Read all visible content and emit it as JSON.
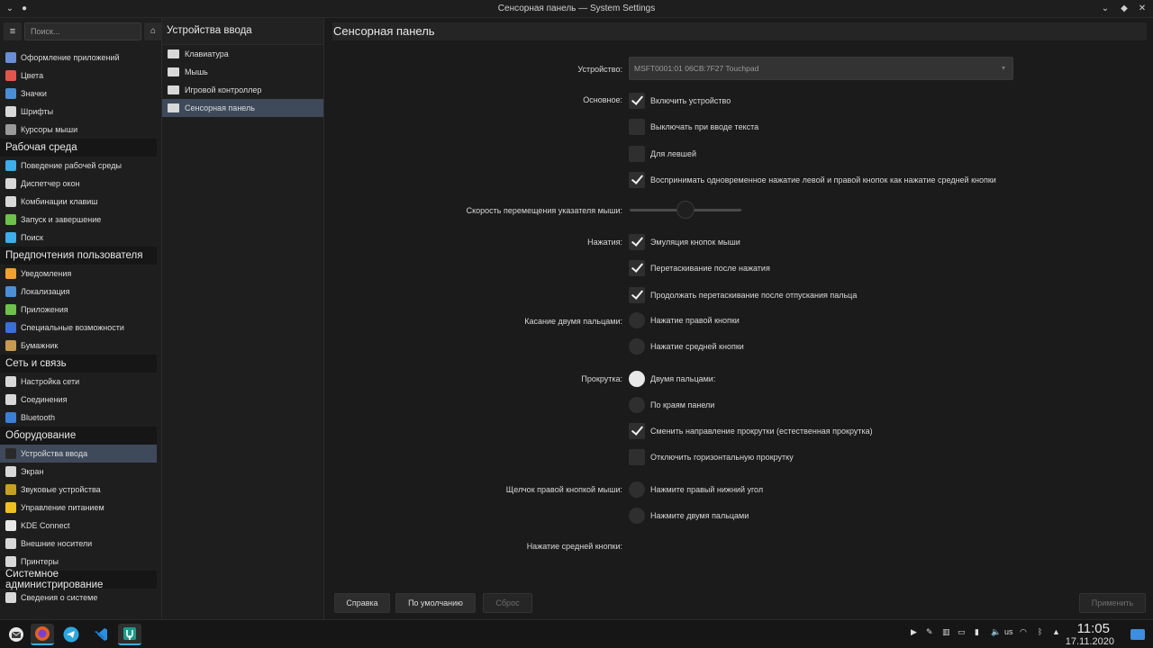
{
  "window": {
    "title": "Сенсорная панель — System Settings",
    "min_icon": "minimize-icon",
    "max_icon": "maximize-icon",
    "close_icon": "close-icon"
  },
  "sidebar": {
    "search_placeholder": "Поиск...",
    "sections": [
      {
        "type": "item",
        "label": "Оформление приложений",
        "icon": "appearance-icon",
        "color": "#6a8fd6"
      },
      {
        "type": "item",
        "label": "Цвета",
        "icon": "colors-icon",
        "color": "#e0564a"
      },
      {
        "type": "item",
        "label": "Значки",
        "icon": "icons-icon",
        "color": "#4a8fd6"
      },
      {
        "type": "item",
        "label": "Шрифты",
        "icon": "fonts-icon",
        "color": "#d8d8d8"
      },
      {
        "type": "item",
        "label": "Курсоры мыши",
        "icon": "cursor-icon",
        "color": "#9a9a9a"
      },
      {
        "type": "category",
        "label": "Рабочая среда"
      },
      {
        "type": "item",
        "label": "Поведение рабочей среды",
        "icon": "desktop-behavior-icon",
        "color": "#3daee9"
      },
      {
        "type": "item",
        "label": "Диспетчер окон",
        "icon": "window-manager-icon",
        "color": "#d8d8d8"
      },
      {
        "type": "item",
        "label": "Комбинации клавиш",
        "icon": "shortcuts-icon",
        "color": "#d8d8d8"
      },
      {
        "type": "item",
        "label": "Запуск и завершение",
        "icon": "startup-icon",
        "color": "#6cc24a"
      },
      {
        "type": "item",
        "label": "Поиск",
        "icon": "search-icon",
        "color": "#3daee9"
      },
      {
        "type": "category",
        "label": "Предпочтения пользователя"
      },
      {
        "type": "item",
        "label": "Уведомления",
        "icon": "bell-icon",
        "color": "#f0a030"
      },
      {
        "type": "item",
        "label": "Локализация",
        "icon": "locale-icon",
        "color": "#4a8fd6"
      },
      {
        "type": "item",
        "label": "Приложения",
        "icon": "star-icon",
        "color": "#6cc24a"
      },
      {
        "type": "item",
        "label": "Специальные возможности",
        "icon": "accessibility-icon",
        "color": "#3a6fd6"
      },
      {
        "type": "item",
        "label": "Бумажник",
        "icon": "wallet-icon",
        "color": "#c89a50"
      },
      {
        "type": "category",
        "label": "Сеть и связь"
      },
      {
        "type": "item",
        "label": "Настройка сети",
        "icon": "network-icon",
        "color": "#d8d8d8"
      },
      {
        "type": "item",
        "label": "Соединения",
        "icon": "connections-icon",
        "color": "#d8d8d8"
      },
      {
        "type": "item",
        "label": "Bluetooth",
        "icon": "bluetooth-icon",
        "color": "#3a7fd6"
      },
      {
        "type": "category",
        "label": "Оборудование"
      },
      {
        "type": "item",
        "label": "Устройства ввода",
        "icon": "input-devices-icon",
        "color": "#2a2a2a",
        "active": true
      },
      {
        "type": "item",
        "label": "Экран",
        "icon": "display-icon",
        "color": "#d8d8d8"
      },
      {
        "type": "item",
        "label": "Звуковые устройства",
        "icon": "speaker-icon",
        "color": "#c8a020"
      },
      {
        "type": "item",
        "label": "Управление питанием",
        "icon": "power-icon",
        "color": "#f0c020"
      },
      {
        "type": "item",
        "label": "KDE Connect",
        "icon": "kde-connect-icon",
        "color": "#e8e8e8"
      },
      {
        "type": "item",
        "label": "Внешние носители",
        "icon": "removable-storage-icon",
        "color": "#d8d8d8"
      },
      {
        "type": "item",
        "label": "Принтеры",
        "icon": "printer-icon",
        "color": "#d8d8d8"
      },
      {
        "type": "category",
        "label": "Системное администрирование"
      },
      {
        "type": "item",
        "label": "Сведения о системе",
        "icon": "info-icon",
        "color": "#d8d8d8"
      }
    ]
  },
  "midpanel": {
    "title": "Устройства ввода",
    "items": [
      {
        "label": "Клавиатура",
        "icon": "keyboard-icon"
      },
      {
        "label": "Мышь",
        "icon": "mouse-icon"
      },
      {
        "label": "Игровой контроллер",
        "icon": "gamepad-icon"
      },
      {
        "label": "Сенсорная панель",
        "icon": "touchpad-icon",
        "active": true
      }
    ]
  },
  "main": {
    "title": "Сенсорная панель",
    "device_label": "Устройство:",
    "device_value": "MSFT0001:01 06CB:7F27 Touchpad",
    "general_label": "Основное:",
    "general": [
      {
        "label": "Включить устройство",
        "checked": true
      },
      {
        "label": "Выключать при вводе текста",
        "checked": false
      },
      {
        "label": "Для левшей",
        "checked": false
      },
      {
        "label": "Воспринимать одновременное нажатие левой и правой кнопок как нажатие средней кнопки",
        "checked": true
      }
    ],
    "speed_label": "Скорость перемещения указателя мыши:",
    "speed_value": 0.5,
    "taps_label": "Нажатия:",
    "taps": [
      {
        "label": "Эмуляция кнопок мыши",
        "checked": true
      },
      {
        "label": "Перетаскивание после нажатия",
        "checked": true
      },
      {
        "label": "Продолжать перетаскивание после отпускания пальца",
        "checked": true
      }
    ],
    "twofinger_label": "Касание двумя пальцами:",
    "twofinger": [
      {
        "label": "Нажатие правой кнопки",
        "checked": false
      },
      {
        "label": "Нажатие средней кнопки",
        "checked": false
      }
    ],
    "scroll_label": "Прокрутка:",
    "scroll_radios": [
      {
        "label": "Двумя пальцами:",
        "checked": true
      },
      {
        "label": "По краям панели",
        "checked": false
      }
    ],
    "scroll_checks": [
      {
        "label": "Сменить направление прокрутки (естественная прокрутка)",
        "checked": true
      },
      {
        "label": "Отключить горизонтальную прокрутку",
        "checked": false
      }
    ],
    "rightclick_label": "Щелчок правой кнопкой мыши:",
    "rightclick": [
      {
        "label": "Нажмите правый нижний угол",
        "checked": false
      },
      {
        "label": "Нажмите двумя пальцами",
        "checked": false
      }
    ],
    "middleclick_label": "Нажатие средней кнопки:"
  },
  "buttons": {
    "help": "Справка",
    "defaults": "По умолчанию",
    "reset": "Сброс",
    "apply": "Применить"
  },
  "taskbar": {
    "apps": [
      "app-launcher-icon",
      "firefox-icon",
      "telegram-icon",
      "vscode-icon",
      "system-settings-icon"
    ],
    "tray_kb_layout": "us",
    "time": "11:05",
    "date": "17.11.2020"
  },
  "colors": {
    "accent": "#3daee9",
    "selection": "#3e4a5a"
  }
}
